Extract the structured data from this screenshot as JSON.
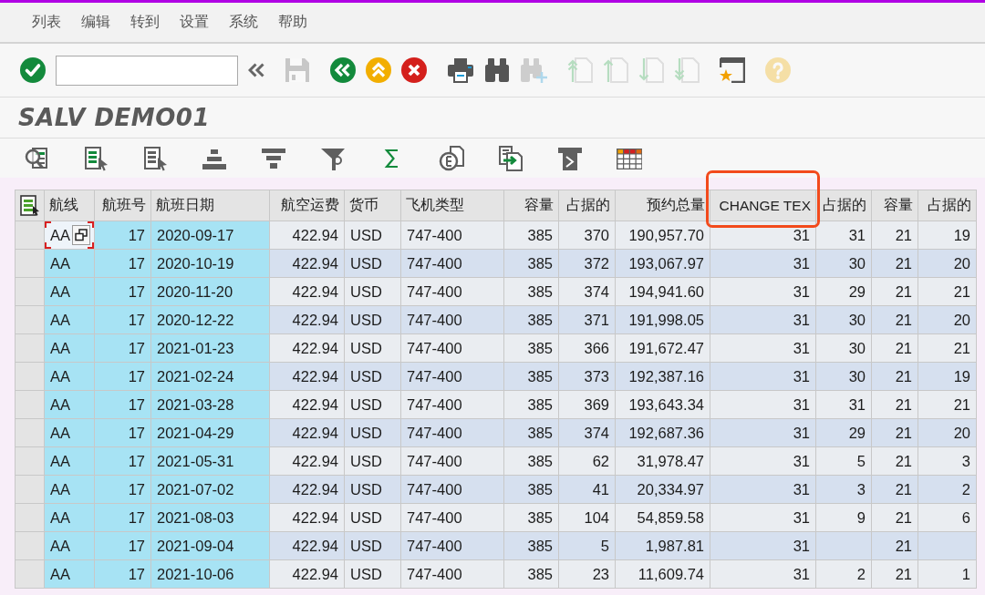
{
  "menu": [
    "列表",
    "编辑",
    "转到",
    "设置",
    "系统",
    "帮助"
  ],
  "toolbar": [
    {
      "buttons": [
        {
          "kind": "confirm",
          "disabled": false
        },
        {
          "kind": "command_field",
          "disabled": false
        },
        {
          "kind": "collapse",
          "disabled": false
        }
      ]
    },
    {
      "buttons": [
        {
          "kind": "save",
          "disabled": true
        }
      ]
    },
    {
      "buttons": [
        {
          "kind": "back",
          "disabled": false
        },
        {
          "kind": "exit",
          "disabled": false
        },
        {
          "kind": "cancel",
          "disabled": false
        }
      ]
    },
    {
      "buttons": [
        {
          "kind": "print",
          "disabled": false
        },
        {
          "kind": "find",
          "disabled": false
        },
        {
          "kind": "find_next",
          "disabled": true
        }
      ]
    },
    {
      "buttons": [
        {
          "kind": "first_page",
          "disabled": true
        },
        {
          "kind": "previous_page",
          "disabled": true
        },
        {
          "kind": "next_page",
          "disabled": true
        },
        {
          "kind": "last_page",
          "disabled": true
        }
      ]
    },
    {
      "buttons": [
        {
          "kind": "new_window",
          "disabled": false
        }
      ]
    },
    {
      "buttons": [
        {
          "kind": "help",
          "disabled": true
        }
      ]
    }
  ],
  "title": "SALV DEMO01",
  "alv_toolbar": [
    {
      "kind": "magnifier"
    },
    {
      "kind": "list_cursor"
    },
    {
      "kind": "page_cursor"
    },
    {
      "kind": "stack_up"
    },
    {
      "kind": "stack_down"
    },
    {
      "kind": "funnel"
    },
    {
      "kind": "sigma"
    },
    {
      "kind": "page_circle"
    },
    {
      "kind": "page_arrow"
    },
    {
      "kind": "banner"
    },
    {
      "kind": "grid"
    }
  ],
  "table": {
    "columns": [
      {
        "label": "航线",
        "kind": "char",
        "key": true,
        "highlighted": false
      },
      {
        "label": "航班号",
        "kind": "num",
        "key": true,
        "highlighted": false
      },
      {
        "label": "航班日期",
        "kind": "char",
        "key": true,
        "highlighted": false
      },
      {
        "label": "航空运费",
        "kind": "num",
        "key": false,
        "highlighted": false
      },
      {
        "label": "货币",
        "kind": "char",
        "key": false,
        "highlighted": false
      },
      {
        "label": "飞机类型",
        "kind": "char",
        "key": false,
        "highlighted": false
      },
      {
        "label": "容量",
        "kind": "num",
        "key": false,
        "highlighted": false
      },
      {
        "label": "占据的",
        "kind": "num",
        "key": false,
        "highlighted": false
      },
      {
        "label": "预约总量",
        "kind": "num",
        "key": false,
        "highlighted": false
      },
      {
        "label": "CHANGE TEX",
        "kind": "num",
        "key": false,
        "highlighted": true
      },
      {
        "label": "占据的",
        "kind": "num",
        "key": false,
        "highlighted": false
      },
      {
        "label": "容量",
        "kind": "num",
        "key": false,
        "highlighted": false
      },
      {
        "label": "占据的",
        "kind": "num",
        "key": false,
        "highlighted": false
      }
    ],
    "rows": [
      {
        "focused": true,
        "cells": [
          "AA",
          "17",
          "2020-09-17",
          "422.94",
          "USD",
          "747-400",
          "385",
          "370",
          "190,957.70",
          "31",
          "31",
          "21",
          "19"
        ]
      },
      {
        "focused": false,
        "cells": [
          "AA",
          "17",
          "2020-10-19",
          "422.94",
          "USD",
          "747-400",
          "385",
          "372",
          "193,067.97",
          "31",
          "30",
          "21",
          "20"
        ]
      },
      {
        "focused": false,
        "cells": [
          "AA",
          "17",
          "2020-11-20",
          "422.94",
          "USD",
          "747-400",
          "385",
          "374",
          "194,941.60",
          "31",
          "29",
          "21",
          "21"
        ]
      },
      {
        "focused": false,
        "cells": [
          "AA",
          "17",
          "2020-12-22",
          "422.94",
          "USD",
          "747-400",
          "385",
          "371",
          "191,998.05",
          "31",
          "30",
          "21",
          "20"
        ]
      },
      {
        "focused": false,
        "cells": [
          "AA",
          "17",
          "2021-01-23",
          "422.94",
          "USD",
          "747-400",
          "385",
          "366",
          "191,672.47",
          "31",
          "30",
          "21",
          "21"
        ]
      },
      {
        "focused": false,
        "cells": [
          "AA",
          "17",
          "2021-02-24",
          "422.94",
          "USD",
          "747-400",
          "385",
          "373",
          "192,387.16",
          "31",
          "30",
          "21",
          "19"
        ]
      },
      {
        "focused": false,
        "cells": [
          "AA",
          "17",
          "2021-03-28",
          "422.94",
          "USD",
          "747-400",
          "385",
          "369",
          "193,643.34",
          "31",
          "31",
          "21",
          "21"
        ]
      },
      {
        "focused": false,
        "cells": [
          "AA",
          "17",
          "2021-04-29",
          "422.94",
          "USD",
          "747-400",
          "385",
          "374",
          "192,687.36",
          "31",
          "29",
          "21",
          "20"
        ]
      },
      {
        "focused": false,
        "cells": [
          "AA",
          "17",
          "2021-05-31",
          "422.94",
          "USD",
          "747-400",
          "385",
          "62",
          "31,978.47",
          "31",
          "5",
          "21",
          "3"
        ]
      },
      {
        "focused": false,
        "cells": [
          "AA",
          "17",
          "2021-07-02",
          "422.94",
          "USD",
          "747-400",
          "385",
          "41",
          "20,334.97",
          "31",
          "3",
          "21",
          "2"
        ]
      },
      {
        "focused": false,
        "cells": [
          "AA",
          "17",
          "2021-08-03",
          "422.94",
          "USD",
          "747-400",
          "385",
          "104",
          "54,859.58",
          "31",
          "9",
          "21",
          "6"
        ]
      },
      {
        "focused": false,
        "cells": [
          "AA",
          "17",
          "2021-09-04",
          "422.94",
          "USD",
          "747-400",
          "385",
          "5",
          "1,987.81",
          "31",
          null,
          "21",
          null
        ]
      },
      {
        "focused": false,
        "cells": [
          "AA",
          "17",
          "2021-10-06",
          "422.94",
          "USD",
          "747-400",
          "385",
          "23",
          "11,609.74",
          "31",
          "2",
          "21",
          "1"
        ]
      }
    ]
  }
}
